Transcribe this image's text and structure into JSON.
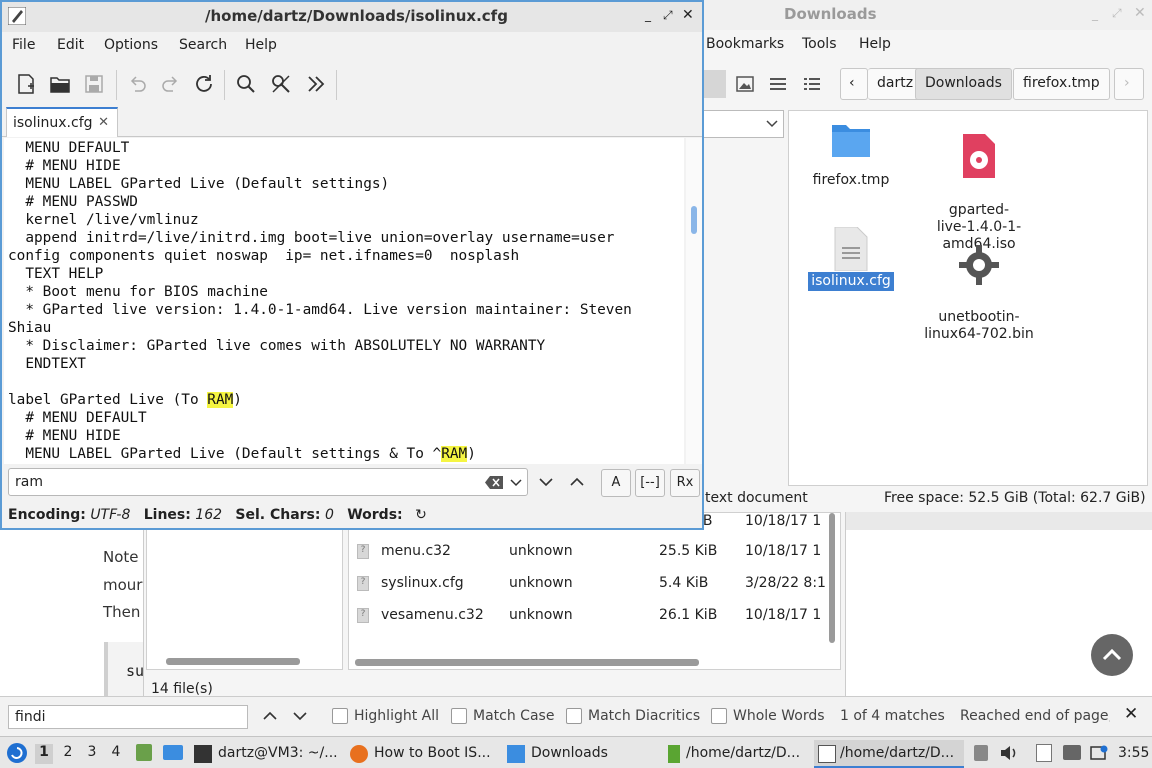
{
  "editor": {
    "title": "/home/dartz/Downloads/isolinux.cfg",
    "menu": [
      "File",
      "Edit",
      "Options",
      "Search",
      "Help"
    ],
    "tab_label": "isolinux.cfg",
    "lines": [
      [
        "  MENU DEFAULT"
      ],
      [
        "  # MENU HIDE"
      ],
      [
        "  MENU LABEL GParted Live (Default settings)"
      ],
      [
        "  # MENU PASSWD"
      ],
      [
        "  kernel /live/vmlinuz"
      ],
      [
        "  append initrd=/live/initrd.img boot=live union=overlay username=user"
      ],
      [
        "config components quiet noswap  ip= net.ifnames=0  nosplash"
      ],
      [
        "  TEXT HELP"
      ],
      [
        "  * Boot menu for BIOS machine"
      ],
      [
        "  * GParted live version: 1.4.0-1-amd64. Live version maintainer: Steven"
      ],
      [
        "Shiau"
      ],
      [
        "  * Disclaimer: GParted live comes with ABSOLUTELY NO WARRANTY"
      ],
      [
        "  ENDTEXT"
      ],
      [
        ""
      ],
      [
        "label GParted Live (To ",
        {
          "hl": "RAM"
        },
        ")"
      ],
      [
        "  # MENU DEFAULT"
      ],
      [
        "  # MENU HIDE"
      ],
      [
        "  MENU LABEL GParted Live (Default settings & To ^",
        {
          "hl": "RAM"
        },
        ")"
      ]
    ],
    "find_value": "ram",
    "find_buttons": [
      "A",
      "[--]",
      "Rx"
    ],
    "status": {
      "encoding_label": "Encoding:",
      "encoding": "UTF-8",
      "lines_label": "Lines:",
      "lines": "162",
      "sel_label": "Sel. Chars:",
      "sel": "0",
      "words_label": "Words:"
    }
  },
  "file_manager": {
    "title": "Downloads",
    "menu_visible": [
      "Bookmarks",
      "Tools",
      "Help"
    ],
    "breadcrumbs": [
      "dartz",
      "Downloads",
      "firefox.tmp"
    ],
    "items": [
      {
        "name": "firefox.tmp",
        "icon": "folder-icon"
      },
      {
        "name": "gparted-\nlive-1.4.0-1-\namd64.iso",
        "icon": "disc-image-icon"
      },
      {
        "name": "isolinux.cfg",
        "icon": "text-file-icon",
        "selected": true
      },
      {
        "name": "unetbootin-\nlinux64-702.bin",
        "icon": "gear-icon"
      }
    ],
    "status_left": "text document",
    "status_right": "Free space: 52.5 GiB (Total: 62.7 GiB)"
  },
  "file_manager2": {
    "rows": [
      {
        "name": "menu.c32",
        "type": "unknown",
        "size": "25.5 KiB",
        "date": "10/18/17 1"
      },
      {
        "name": "syslinux.cfg",
        "type": "unknown",
        "size": "5.4 KiB",
        "date": "3/28/22 8:1"
      },
      {
        "name": "vesamenu.c32",
        "type": "unknown",
        "size": "26.1 KiB",
        "date": "10/18/17 1"
      }
    ],
    "partial_date_top": "10/18/17 1",
    "partial_size_top": "iB",
    "file_count": "14 file(s)"
  },
  "webpage": {
    "line1": "Note",
    "line2": "mour",
    "line3": "Then",
    "code": "su"
  },
  "findbar": {
    "value": "findi",
    "options": [
      "Highlight All",
      "Match Case",
      "Match Diacritics",
      "Whole Words"
    ],
    "matches": "1 of 4 matches",
    "message": "Reached end of page, c"
  },
  "taskbar": {
    "workspaces": [
      "1",
      "2",
      "3",
      "4"
    ],
    "tasks": [
      {
        "label": "dartz@VM3: ~/...",
        "icon": "terminal-icon"
      },
      {
        "label": "How to Boot IS...",
        "icon": "firefox-icon"
      },
      {
        "label": "Downloads",
        "icon": "folder-icon"
      },
      {
        "label": "/home/dartz/D...",
        "icon": "document-icon"
      },
      {
        "label": "/home/dartz/D...",
        "icon": "text-editor-icon"
      }
    ],
    "clock": "3:55"
  }
}
